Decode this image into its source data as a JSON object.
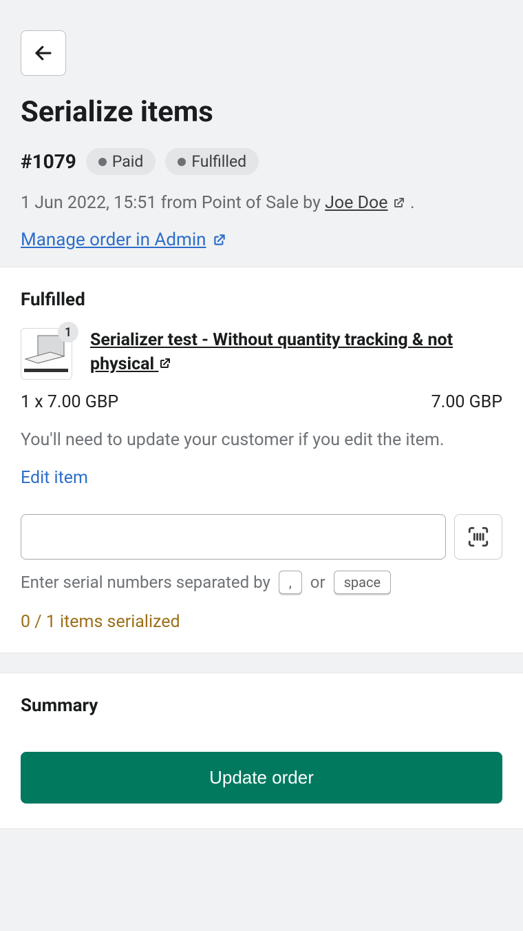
{
  "pageTitle": "Serialize items",
  "orderNumber": "#1079",
  "badges": {
    "paid": "Paid",
    "fulfilled": "Fulfilled"
  },
  "meta": {
    "prefix": "1 Jun 2022, 15:51 from Point of Sale by ",
    "staff": "Joe Doe",
    "suffix": " ."
  },
  "manageLink": "Manage order in Admin",
  "fulfilled": {
    "title": "Fulfilled",
    "qtyBadge": "1",
    "productName": "Serializer test - Without quantity tracking & not physical",
    "qtyPrice": "1 x 7.00 GBP",
    "lineTotal": "7.00 GBP",
    "editHint": "You'll need to update your customer if you edit the item.",
    "editItem": "Edit item",
    "separatorHint": {
      "prefix": "Enter serial numbers separated by",
      "comma": ",",
      "or": "or",
      "space": "space"
    },
    "serialCount": "0 / 1 items serialized"
  },
  "summary": {
    "title": "Summary",
    "button": "Update order"
  }
}
